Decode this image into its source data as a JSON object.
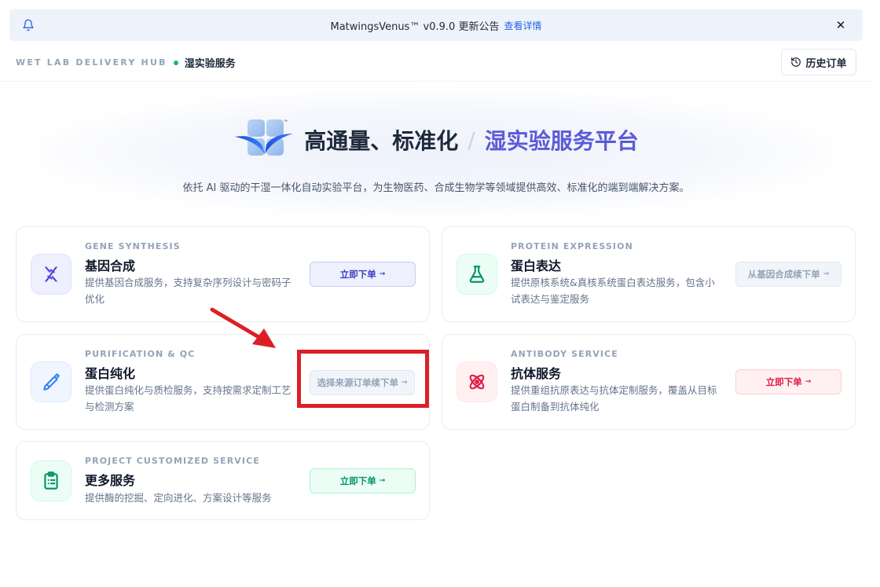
{
  "notice": {
    "message": "MatwingsVenus™ v0.9.0 更新公告",
    "link": "查看详情",
    "icon": "bell-icon",
    "close": "✕"
  },
  "header": {
    "hub": "WET LAB DELIVERY HUB",
    "current": "湿实验服务",
    "history_button": "历史订单"
  },
  "hero": {
    "title_main": "高通量、标准化",
    "separator": "/",
    "title_accent": "湿实验服务平台",
    "subtitle": "依托 AI 驱动的干湿一体化自动实验平台，为生物医药、合成生物学等领域提供高效、标准化的端到端解决方案。"
  },
  "services": [
    {
      "en": "GENE SYNTHESIS",
      "zh": "基因合成",
      "desc": "提供基因合成服务，支持复杂序列设计与密码子优化",
      "button": "立即下单",
      "icon": "dna-icon",
      "accent": "#4f46e5"
    },
    {
      "en": "PROTEIN EXPRESSION",
      "zh": "蛋白表达",
      "desc": "提供原核系统&真核系统蛋白表达服务，包含小试表达与鉴定服务",
      "button": "从基因合成续下单",
      "icon": "flask-icon",
      "accent": "#059669"
    },
    {
      "en": "PURIFICATION & QC",
      "zh": "蛋白纯化",
      "desc": "提供蛋白纯化与质检服务，支持按需求定制工艺与检测方案",
      "button": "选择来源订单续下单",
      "icon": "pipette-icon",
      "accent": "#3b82f6"
    },
    {
      "en": "ANTIBODY SERVICE",
      "zh": "抗体服务",
      "desc": "提供重组抗原表达与抗体定制服务，覆盖从目标蛋白制备到抗体纯化",
      "button": "立即下单",
      "icon": "atom-icon",
      "accent": "#e11d48"
    },
    {
      "en": "PROJECT CUSTOMIZED SERVICE",
      "zh": "更多服务",
      "desc": "提供酶的挖掘、定向进化、方案设计等服务",
      "button": "立即下单",
      "icon": "clipboard-icon",
      "accent": "#059669"
    }
  ],
  "arrow_glyph": "→"
}
